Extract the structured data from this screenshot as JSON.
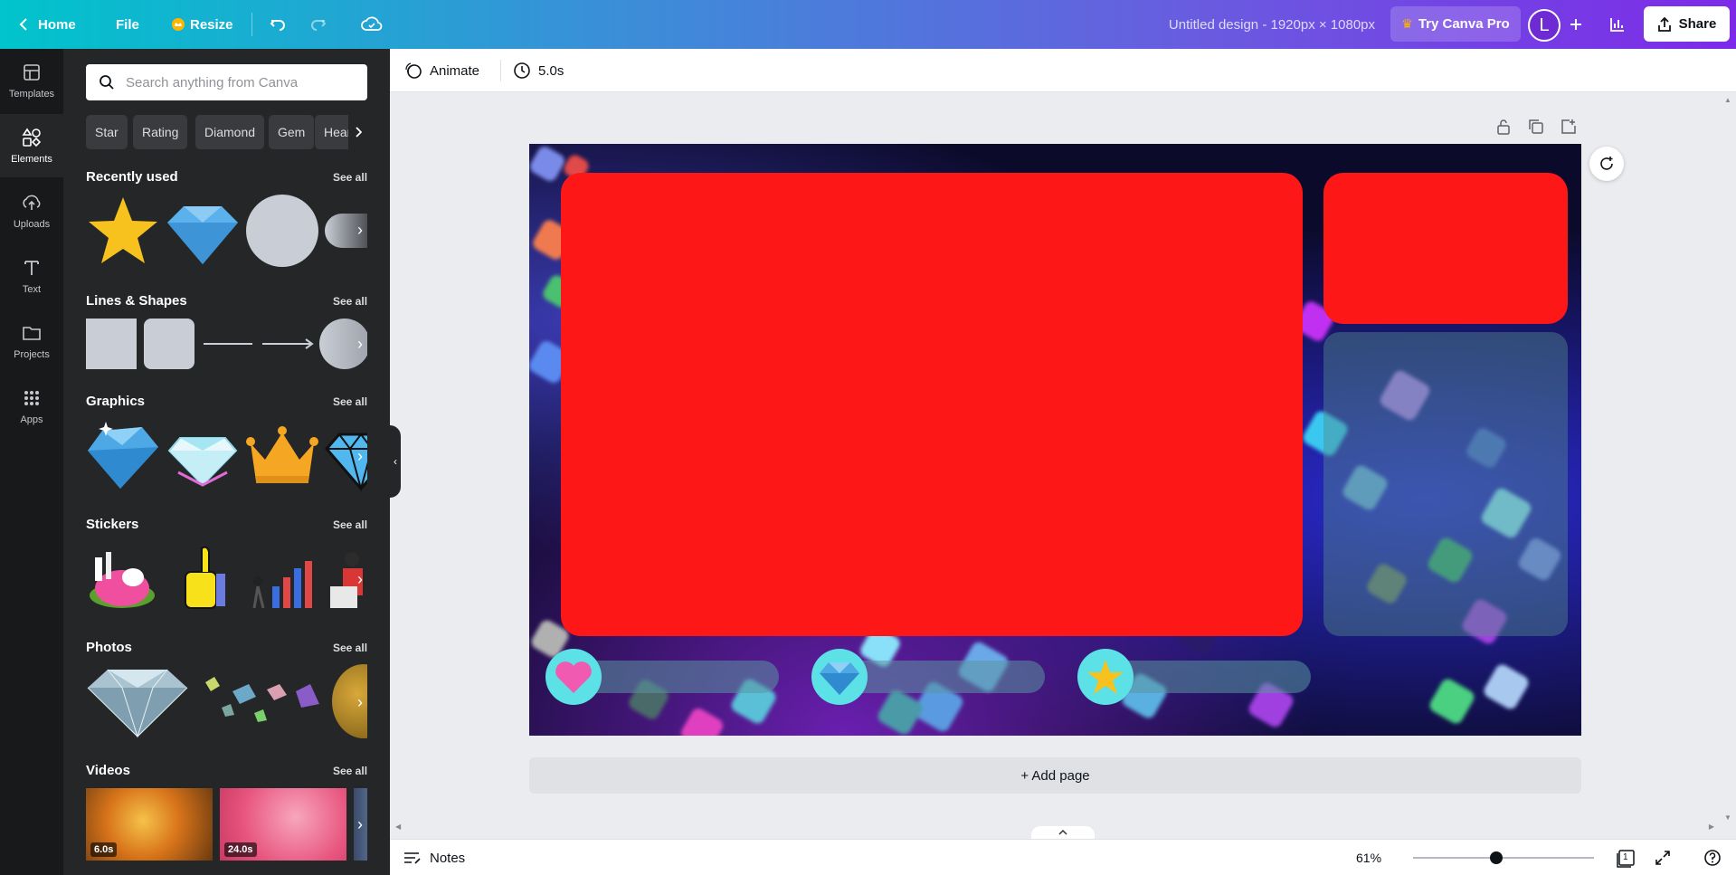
{
  "topbar": {
    "home_label": "Home",
    "file_label": "File",
    "resize_label": "Resize",
    "doc_title": "Untitled design - 1920px × 1080px",
    "pro_label": "Try Canva Pro",
    "avatar_letter": "L",
    "share_label": "Share"
  },
  "rail": {
    "items": [
      {
        "label": "Templates",
        "icon": "templates-icon"
      },
      {
        "label": "Elements",
        "icon": "elements-icon"
      },
      {
        "label": "Uploads",
        "icon": "uploads-icon"
      },
      {
        "label": "Text",
        "icon": "text-icon"
      },
      {
        "label": "Projects",
        "icon": "projects-icon"
      },
      {
        "label": "Apps",
        "icon": "apps-icon"
      }
    ]
  },
  "panel": {
    "search_placeholder": "Search anything from Canva",
    "chips": [
      "Star",
      "Rating",
      "Diamond",
      "Gem",
      "Heart"
    ],
    "see_all": "See all",
    "sections": {
      "recent": "Recently used",
      "lines": "Lines & Shapes",
      "graphics": "Graphics",
      "stickers": "Stickers",
      "photos": "Photos",
      "videos": "Videos"
    },
    "videos": [
      {
        "duration": "6.0s"
      },
      {
        "duration": "24.0s"
      }
    ]
  },
  "editor": {
    "animate_label": "Animate",
    "duration_label": "5.0s",
    "add_page_label": "+ Add page"
  },
  "bottombar": {
    "notes_label": "Notes",
    "zoom": "61%",
    "page_count": "1"
  },
  "colors": {
    "accent_red": "#fe1717",
    "icon_cyan": "#5ce1e6",
    "brand_purple": "#7d2ae8"
  }
}
